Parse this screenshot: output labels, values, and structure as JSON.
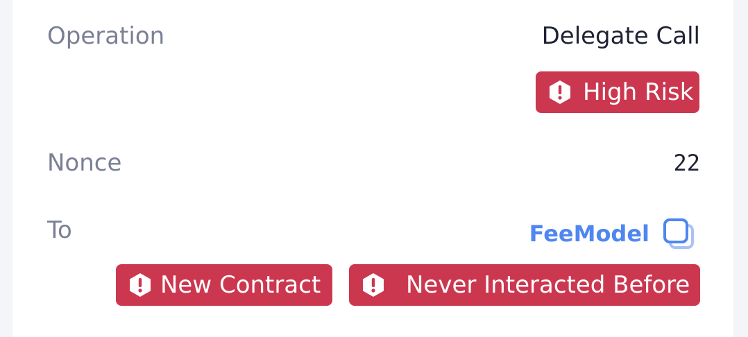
{
  "rows": {
    "operation": {
      "label": "Operation",
      "value": "Delegate Call",
      "badge": "High Risk"
    },
    "nonce": {
      "label": "Nonce",
      "value": "22"
    },
    "to": {
      "label": "To",
      "value": "FeeModel",
      "badges": [
        "New Contract",
        "Never Interacted Before"
      ]
    }
  },
  "icons": {
    "warning": "warning-hexagon-icon",
    "copy": "copy-icon"
  },
  "colors": {
    "danger": "#cc3750",
    "link": "#4f86f0",
    "label": "#7b7f95",
    "text": "#1f2233"
  }
}
